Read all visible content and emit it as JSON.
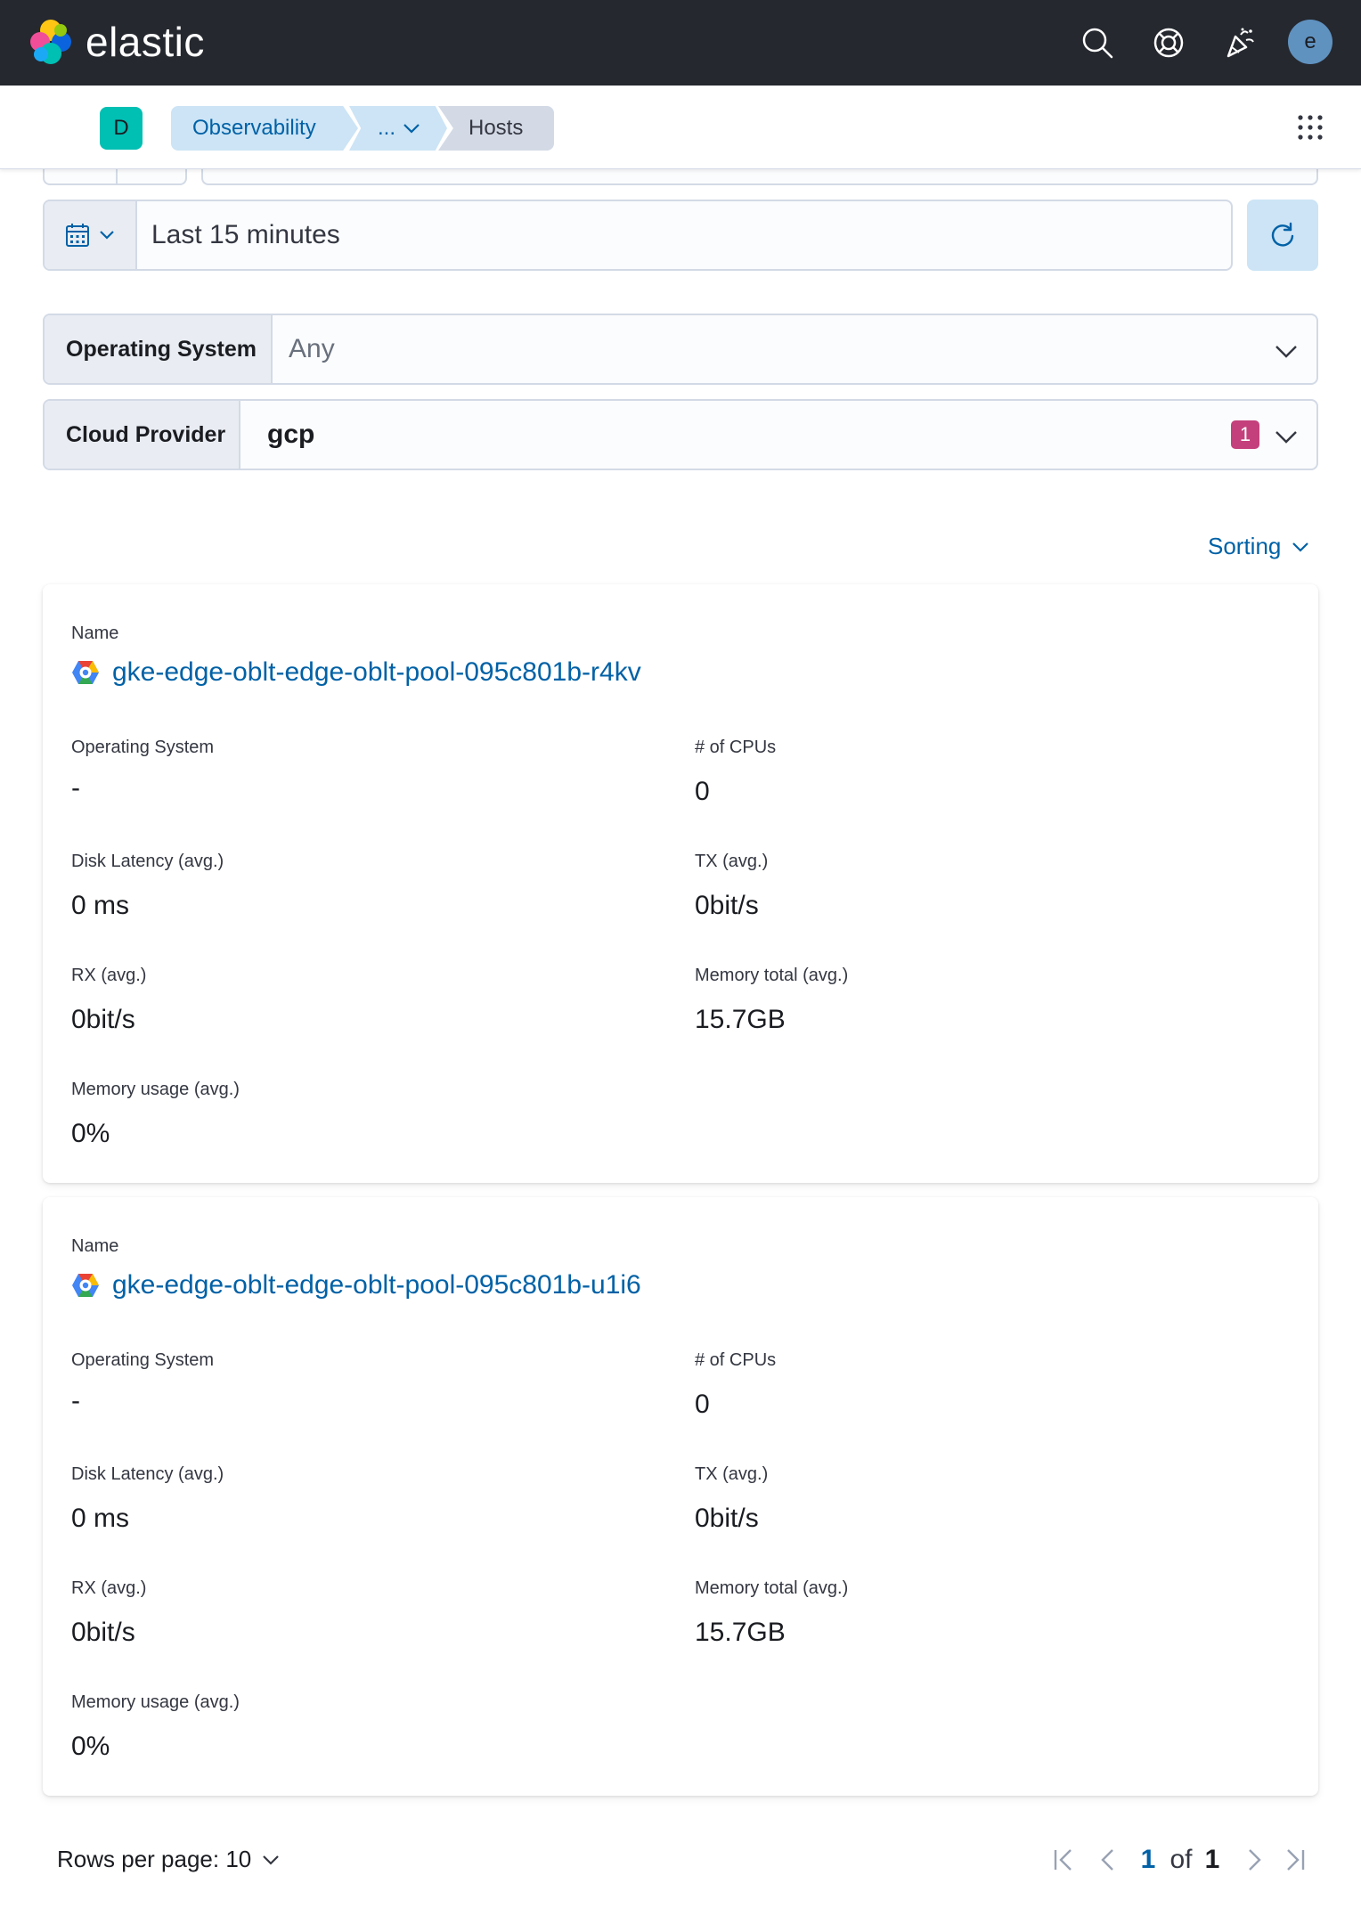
{
  "header": {
    "logo_text": "elastic",
    "avatar_initial": "e"
  },
  "navbar": {
    "space_initial": "D",
    "breadcrumbs": [
      "Observability",
      "...",
      "Hosts"
    ]
  },
  "date_picker": {
    "value": "Last 15 minutes"
  },
  "filters": {
    "operating_system": {
      "label": "Operating System",
      "value": "Any"
    },
    "cloud_provider": {
      "label": "Cloud Provider",
      "value": "gcp",
      "selected_count": "1"
    }
  },
  "sorting_label": "Sorting",
  "hosts": [
    {
      "name_label": "Name",
      "name": "gke-edge-oblt-edge-oblt-pool-095c801b-r4kv",
      "os_label": "Operating System",
      "os": "-",
      "cpus_label": "# of CPUs",
      "cpus": "0",
      "disk_label": "Disk Latency (avg.)",
      "disk": "0 ms",
      "tx_label": "TX (avg.)",
      "tx": "0bit/s",
      "rx_label": "RX (avg.)",
      "rx": "0bit/s",
      "memtotal_label": "Memory total (avg.)",
      "memtotal": "15.7GB",
      "memusage_label": "Memory usage (avg.)",
      "memusage": "0%"
    },
    {
      "name_label": "Name",
      "name": "gke-edge-oblt-edge-oblt-pool-095c801b-u1i6",
      "os_label": "Operating System",
      "os": "-",
      "cpus_label": "# of CPUs",
      "cpus": "0",
      "disk_label": "Disk Latency (avg.)",
      "disk": "0 ms",
      "tx_label": "TX (avg.)",
      "tx": "0bit/s",
      "rx_label": "RX (avg.)",
      "rx": "0bit/s",
      "memtotal_label": "Memory total (avg.)",
      "memtotal": "15.7GB",
      "memusage_label": "Memory usage (avg.)",
      "memusage": "0%"
    }
  ],
  "pagination": {
    "rows_per_page": "Rows per page: 10",
    "current_page": "1",
    "of_label": "of",
    "total_pages": "1"
  },
  "colors": {
    "header_bg": "#25282f",
    "link": "#0061a6",
    "accent_teal": "#00bfb3",
    "badge_pink": "#c4407c"
  }
}
